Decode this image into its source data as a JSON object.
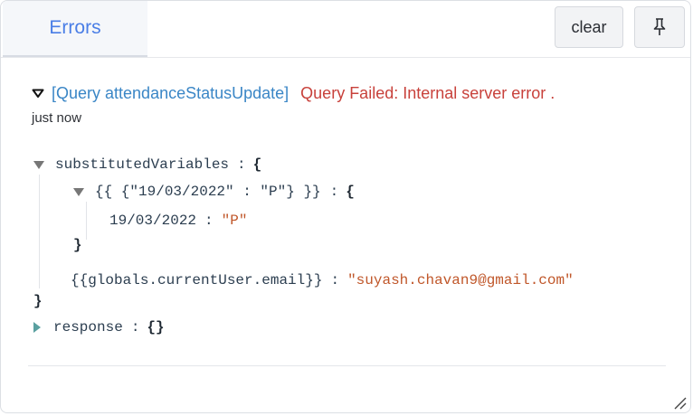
{
  "tab": {
    "label": "Errors"
  },
  "toolbar": {
    "clear_label": "clear",
    "pin_icon": "pin-icon"
  },
  "error": {
    "query": "[Query attendanceStatusUpdate]",
    "message": "Query Failed: Internal server error .",
    "time": "just now"
  },
  "tree": {
    "substituted_key": "substitutedVariables",
    "colon": ":",
    "open_brace": "{",
    "close_brace": "}",
    "nested_key": "{{ {\"19/03/2022\" : \"P\"} }}",
    "date_key": "19/03/2022",
    "date_value": "\"P\"",
    "globals_key": "{{globals.currentUser.email}}",
    "globals_value": "\"suyash.chavan9@gmail.com\"",
    "response_key": "response",
    "response_value": "{}"
  },
  "colors": {
    "accent": "#4a7ee6",
    "error": "#c8413b",
    "link": "#3a86c6",
    "string": "#c0572a"
  }
}
